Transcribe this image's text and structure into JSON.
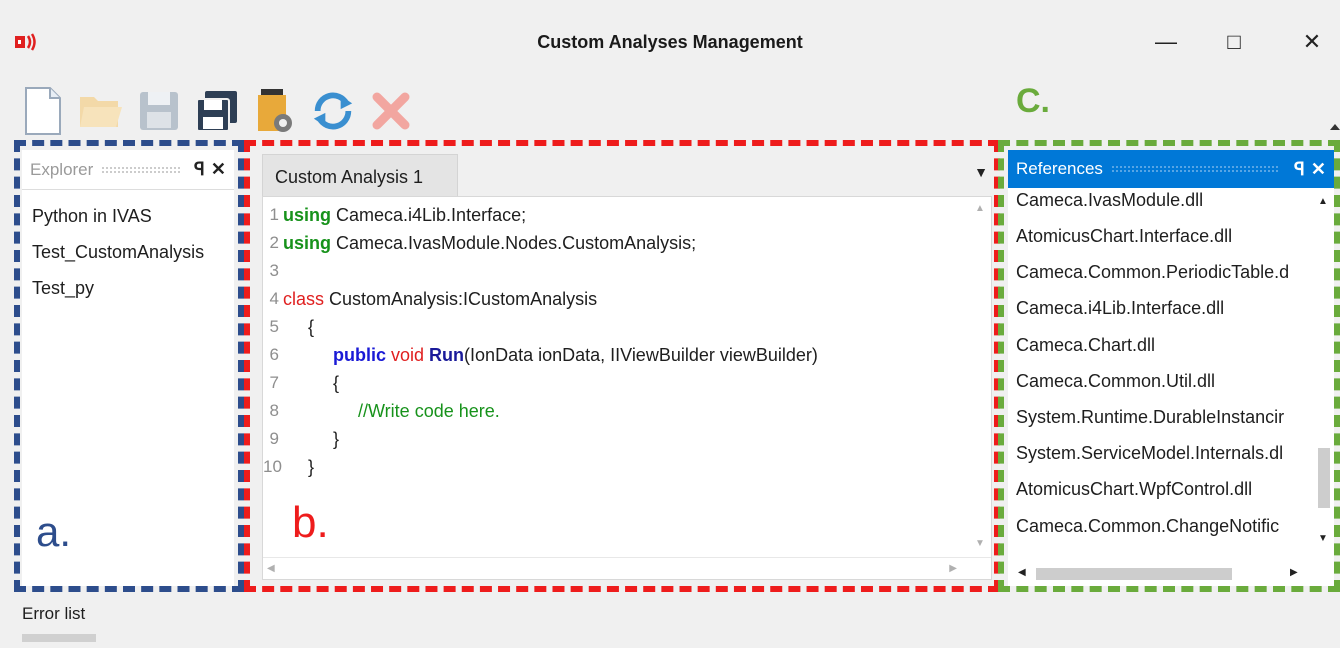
{
  "window": {
    "title": "Custom Analyses Management",
    "minimize": "—",
    "maximize": "□",
    "close": "✕"
  },
  "toolbar": {
    "buttons": [
      "new-file",
      "open-folder",
      "save",
      "save-all",
      "build-settings",
      "refresh",
      "delete"
    ]
  },
  "annotations": {
    "a": "a.",
    "b": "b.",
    "c": "C."
  },
  "explorer": {
    "title": "Explorer",
    "pin": "ꟼ",
    "close": "✕",
    "items": [
      "Python in IVAS",
      "Test_CustomAnalysis",
      "Test_py"
    ]
  },
  "editor": {
    "tab": "Custom Analysis 1",
    "line_numbers": [
      "1",
      "2",
      "3",
      "4",
      "5",
      "6",
      "7",
      "8",
      "9",
      "10"
    ],
    "code": {
      "l1_kw": "using",
      "l1_rest": " Cameca.i4Lib.Interface;",
      "l2_kw": "using",
      "l2_rest": " Cameca.IvasModule.Nodes.CustomAnalysis;",
      "l4_kw": "class",
      "l4_rest": " CustomAnalysis:ICustomAnalysis",
      "l5": "     {",
      "l6_indent": "          ",
      "l6_kw1": "public",
      "l6_kw2": " void ",
      "l6_method": "Run",
      "l6_rest": "(IonData ionData, IIViewBuilder viewBuilder)",
      "l7": "          {",
      "l8_indent": "               ",
      "l8_comment": "//Write code here.",
      "l9": "          }",
      "l10": "     }"
    }
  },
  "references": {
    "title": "References",
    "pin": "ꟼ",
    "close": "✕",
    "items": [
      "Cameca.IvasModule.dll",
      "AtomicusChart.Interface.dll",
      "Cameca.Common.PeriodicTable.d",
      "Cameca.i4Lib.Interface.dll",
      "Cameca.Chart.dll",
      "Cameca.Common.Util.dll",
      "System.Runtime.DurableInstancir",
      "System.ServiceModel.Internals.dl",
      "AtomicusChart.WpfControl.dll",
      "Cameca.Common.ChangeNotific"
    ]
  },
  "footer": {
    "error_list": "Error list"
  },
  "colors": {
    "explorer_border": "#2d4d8c",
    "editor_border": "#ee1c1c",
    "references_border": "#6aab3c",
    "references_header": "#0078d7"
  }
}
